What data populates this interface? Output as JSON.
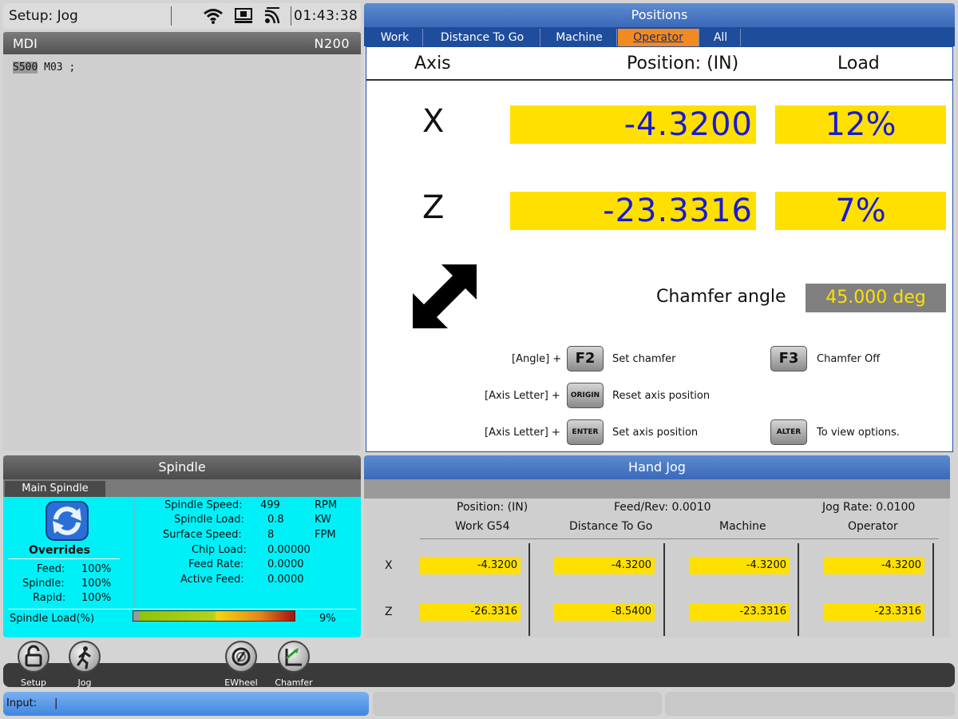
{
  "status": {
    "mode": "Setup: Jog",
    "time": "01:43:38"
  },
  "mdi": {
    "title": "MDI",
    "line_number": "N200",
    "code_highlight": "S500",
    "code_rest": " M03 ;"
  },
  "positions": {
    "title": "Positions",
    "tabs": [
      "Work",
      "Distance To Go",
      "Machine",
      "Operator",
      "All"
    ],
    "active_tab": "Operator",
    "headers": {
      "axis": "Axis",
      "position": "Position:  (IN)",
      "load": "Load"
    },
    "axes": [
      {
        "name": "X",
        "value": "-4.3200",
        "load": "12%"
      },
      {
        "name": "Z",
        "value": "-23.3316",
        "load": "7%"
      }
    ],
    "chamfer_label": "Chamfer angle",
    "chamfer_value": "45.000 deg",
    "keys": {
      "angle_prefix": "[Angle] +",
      "f2": "F2",
      "set_chamfer": "Set chamfer",
      "f3": "F3",
      "chamfer_off": "Chamfer Off",
      "axis_prefix1": "[Axis Letter] +",
      "origin": "ORIGIN",
      "reset_axis": "Reset axis position",
      "axis_prefix2": "[Axis Letter] +",
      "enter": "ENTER",
      "set_axis": "Set axis position",
      "alter": "ALTER",
      "view_options": "To view options."
    }
  },
  "spindle": {
    "title": "Spindle",
    "tab": "Main Spindle",
    "overrides_label": "Overrides",
    "overrides": [
      {
        "label": "Feed:",
        "value": "100%"
      },
      {
        "label": "Spindle:",
        "value": "100%"
      },
      {
        "label": "Rapid:",
        "value": "100%"
      }
    ],
    "stats": [
      {
        "label": "Spindle Speed:",
        "value": "499",
        "unit": "RPM"
      },
      {
        "label": "Spindle Load:",
        "value": "0.8",
        "unit": "KW"
      },
      {
        "label": "Surface Speed:",
        "value": "8",
        "unit": "FPM"
      },
      {
        "label": "Chip Load:",
        "value": "0.00000",
        "unit": ""
      },
      {
        "label": "Feed Rate:",
        "value": "0.0000",
        "unit": ""
      },
      {
        "label": "Active Feed:",
        "value": "0.0000",
        "unit": ""
      }
    ],
    "load_label": "Spindle Load(%)",
    "load_value": "9%",
    "load_fraction": 0.04
  },
  "hand_jog": {
    "title": "Hand Jog",
    "position_label": "Position: (IN)",
    "feed_rev": "Feed/Rev: 0.0010",
    "jog_rate": "Jog Rate: 0.0100",
    "columns": [
      "Work G54",
      "Distance To Go",
      "Machine",
      "Operator"
    ],
    "rows": [
      {
        "axis": "X",
        "values": [
          "-4.3200",
          "-4.3200",
          "-4.3200",
          "-4.3200"
        ]
      },
      {
        "axis": "Z",
        "values": [
          "-26.3316",
          "-8.5400",
          "-23.3316",
          "-23.3316"
        ]
      }
    ]
  },
  "toolbar": {
    "setup": "Setup",
    "jog": "Jog",
    "ewheel": "EWheel",
    "chamfer": "Chamfer"
  },
  "input": {
    "label": "Input:",
    "cursor": "|"
  },
  "colors": {
    "accent_blue": "#3b69b8",
    "value_yellow": "#ffe000",
    "value_blue": "#1a1ad0",
    "active_tab": "#f28a22",
    "cyan": "#00f0f8"
  }
}
